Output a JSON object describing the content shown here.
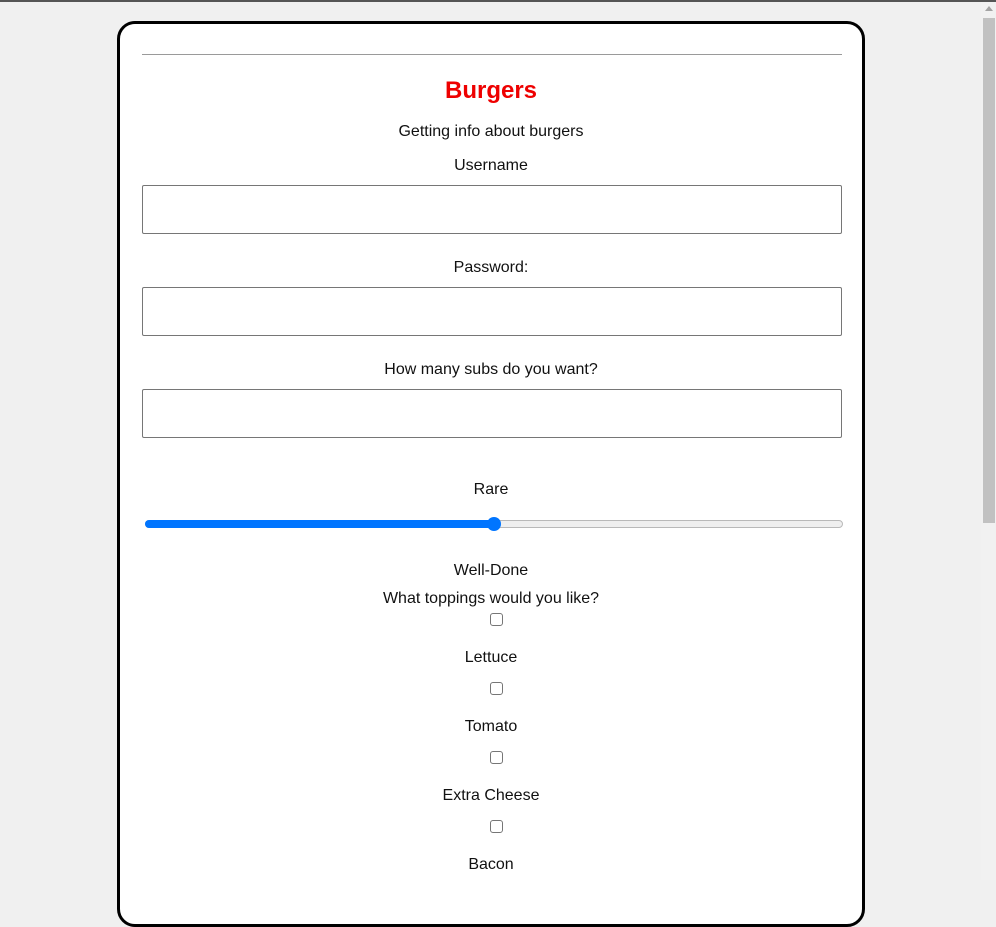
{
  "form": {
    "title": "Burgers",
    "subtitle": "Getting info about burgers",
    "username_label": "Username",
    "username_value": "",
    "password_label": "Password:",
    "password_value": "",
    "subs_label": "How many subs do you want?",
    "subs_value": "",
    "doneness": {
      "min_label": "Rare",
      "max_label": "Well-Done",
      "level": 0.5
    },
    "toppings_label": "What toppings would you like?",
    "toppings": [
      {
        "label": "Lettuce",
        "checked": false
      },
      {
        "label": "Tomato",
        "checked": false
      },
      {
        "label": "Extra Cheese",
        "checked": false
      },
      {
        "label": "Bacon",
        "checked": false
      }
    ]
  },
  "colors": {
    "title": "#ee0000",
    "accent": "#0075ff"
  }
}
